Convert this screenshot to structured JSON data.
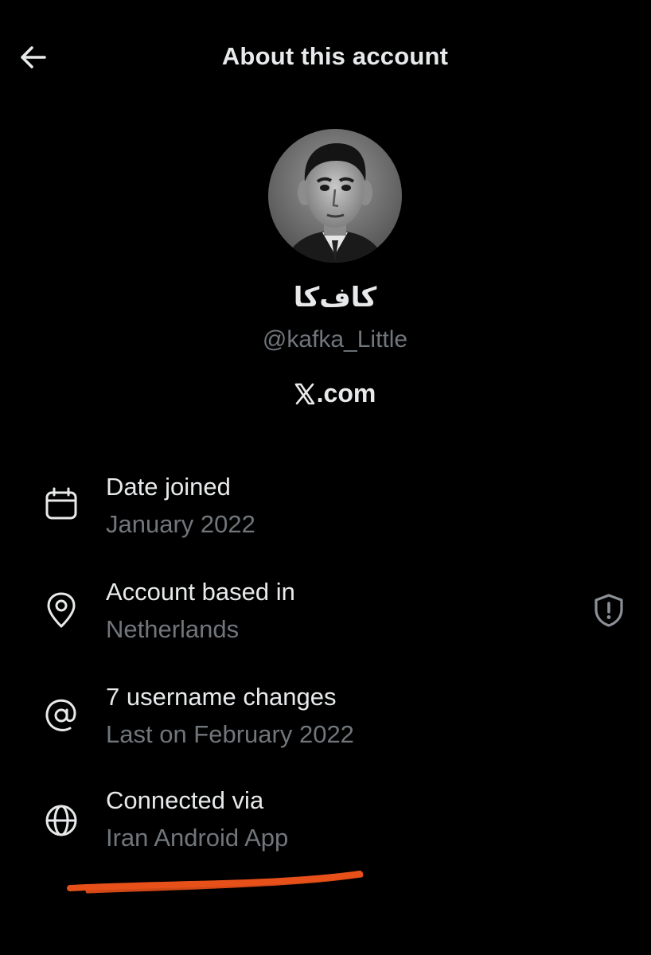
{
  "header": {
    "title": "About this account",
    "back_icon": "arrow-left-icon"
  },
  "profile": {
    "display_name": "کاف‌کا",
    "handle": "@kafka_Little",
    "platform_suffix": ".com",
    "platform_logo": "x-logo-icon"
  },
  "details": [
    {
      "icon": "calendar-icon",
      "title": "Date joined",
      "value": "January 2022"
    },
    {
      "icon": "location-pin-icon",
      "title": "Account based in",
      "value": "Netherlands"
    },
    {
      "icon": "at-sign-icon",
      "title": "7 username changes",
      "value": "Last on February 2022"
    },
    {
      "icon": "globe-icon",
      "title": "Connected via",
      "value": "Iran Android App"
    }
  ],
  "colors": {
    "background": "#000000",
    "primary_text": "#e7e9ea",
    "secondary_text": "#71767b",
    "annotation": "#e8501a"
  }
}
